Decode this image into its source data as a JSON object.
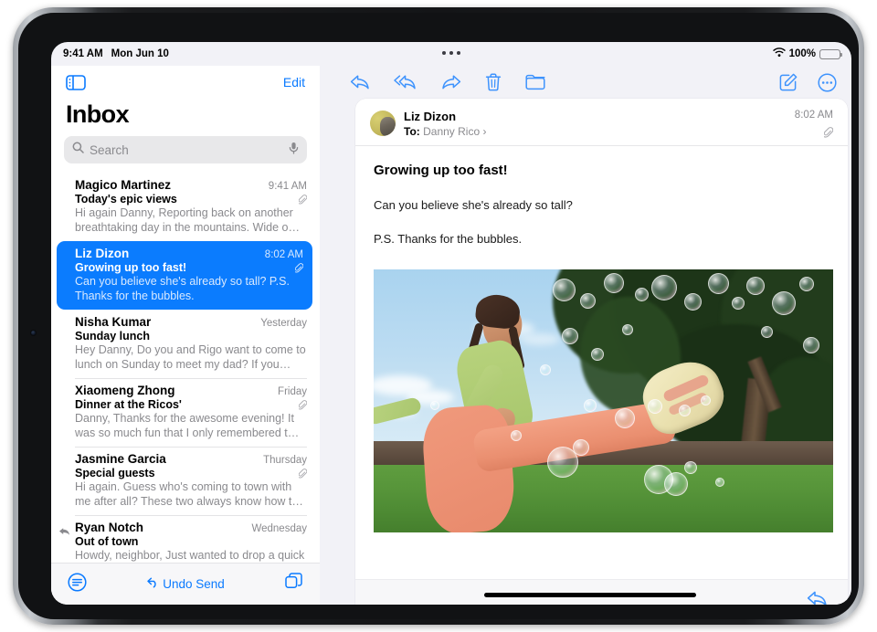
{
  "status_bar": {
    "time": "9:41 AM",
    "date": "Mon Jun 10",
    "battery_percent": "100%",
    "wifi_icon": "wifi-icon",
    "battery_icon": "battery-icon",
    "multitask_icon": "multitasking-handle-icon"
  },
  "sidebar": {
    "toggle_icon": "sidebar-toggle-icon",
    "edit_label": "Edit",
    "title": "Inbox",
    "search": {
      "placeholder": "Search",
      "search_icon": "search-icon",
      "mic_icon": "microphone-icon"
    },
    "messages": [
      {
        "sender": "Magico Martinez",
        "time": "9:41 AM",
        "subject": "Today's epic views",
        "preview": "Hi again Danny, Reporting back on another breathtaking day in the mountains. Wide o…",
        "has_attachment": true,
        "selected": false,
        "replied": false
      },
      {
        "sender": "Liz Dizon",
        "time": "8:02 AM",
        "subject": "Growing up too fast!",
        "preview": "Can you believe she's already so tall? P.S. Thanks for the bubbles.",
        "has_attachment": true,
        "selected": true,
        "replied": false
      },
      {
        "sender": "Nisha Kumar",
        "time": "Yesterday",
        "subject": "Sunday lunch",
        "preview": "Hey Danny, Do you and Rigo want to come to lunch on Sunday to meet my dad? If you…",
        "has_attachment": false,
        "selected": false,
        "replied": false
      },
      {
        "sender": "Xiaomeng Zhong",
        "time": "Friday",
        "subject": "Dinner at the Ricos'",
        "preview": "Danny, Thanks for the awesome evening! It was so much fun that I only remembered t…",
        "has_attachment": true,
        "selected": false,
        "replied": false
      },
      {
        "sender": "Jasmine Garcia",
        "time": "Thursday",
        "subject": "Special guests",
        "preview": "Hi again. Guess who's coming to town with me after all? These two always know how t…",
        "has_attachment": true,
        "selected": false,
        "replied": false
      },
      {
        "sender": "Ryan Notch",
        "time": "Wednesday",
        "subject": "Out of town",
        "preview": "Howdy, neighbor, Just wanted to drop a quick note to let you know we're leaving T…",
        "has_attachment": false,
        "selected": false,
        "replied": true
      }
    ],
    "toolbar": {
      "filter_icon": "filter-icon",
      "undo_send_label": "Undo Send",
      "undo_icon": "undo-arrow-icon",
      "new_window_icon": "new-window-icon"
    }
  },
  "detail": {
    "toolbar": {
      "reply_icon": "reply-icon",
      "reply_all_icon": "reply-all-icon",
      "forward_icon": "forward-icon",
      "trash_icon": "trash-icon",
      "folder_icon": "folder-icon",
      "compose_icon": "compose-icon",
      "more_icon": "more-circle-icon"
    },
    "message": {
      "avatar": "sender-avatar",
      "sender": "Liz Dizon",
      "to_label": "To:",
      "to_recipient": "Danny Rico",
      "disclosure_icon": "chevron-right-icon",
      "time": "8:02 AM",
      "attachment_icon": "paperclip-icon",
      "subject": "Growing up too fast!",
      "paragraphs": [
        "Can you believe she's already so tall?",
        "P.S. Thanks for the bubbles."
      ],
      "photo_alt": "girl-kicking-leg-with-bubbles-photo"
    },
    "bottom_reply_icon": "reply-icon"
  },
  "colors": {
    "accent": "#0a7aff",
    "selected_row": "#0b7cfe",
    "secondary_text": "#8a8a8e",
    "screen_bg": "#f2f2f7"
  }
}
